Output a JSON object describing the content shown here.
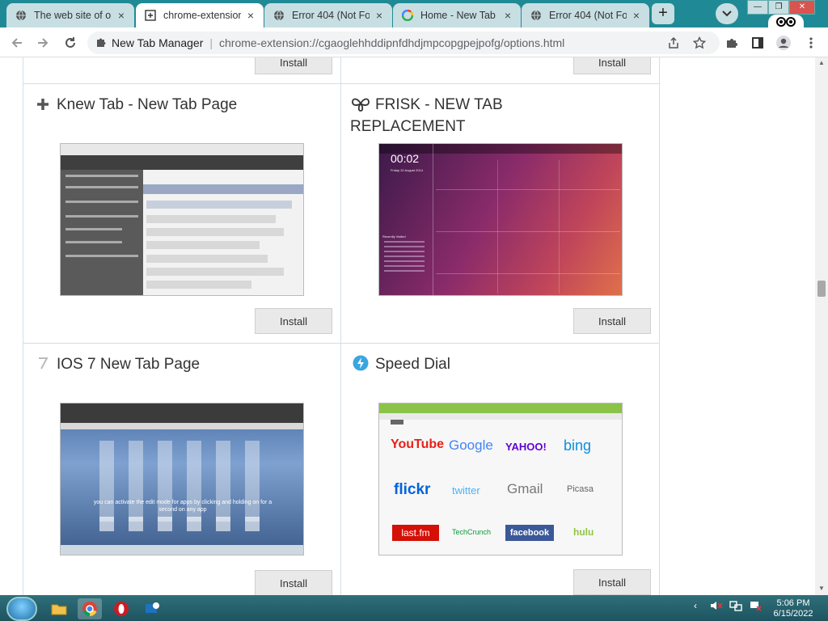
{
  "tabs": [
    {
      "title": "The web site of o",
      "active": false,
      "icon": "globe-icon"
    },
    {
      "title": "chrome-extension",
      "active": true,
      "icon": "extension-page-icon"
    },
    {
      "title": "Error 404 (Not Fo",
      "active": false,
      "icon": "globe-icon"
    },
    {
      "title": "Home - New Tab",
      "active": false,
      "icon": "google-icon"
    },
    {
      "title": "Error 404 (Not Fo",
      "active": false,
      "icon": "globe-icon"
    }
  ],
  "toolbar": {
    "site_name": "New Tab Manager",
    "url": "chrome-extension://cgaoglehhddipnfdhdjmpcopgpejpofg/options.html"
  },
  "cards": [
    {
      "title": "Knew Tab - New Tab Page",
      "icon": "plus-icon",
      "install_label": "Install"
    },
    {
      "title_line1": "FRISK - NEW TAB",
      "title_line2": "REPLACEMENT",
      "icon": "frisk-logo-icon",
      "install_label": "Install"
    },
    {
      "title": "IOS 7 New Tab Page",
      "icon": "seven-icon",
      "install_label": "Install"
    },
    {
      "title": "Speed Dial",
      "icon": "lightning-icon",
      "install_label": "Install"
    }
  ],
  "top_row": {
    "install_left": "Install",
    "install_right": "Install"
  },
  "screenshots": {
    "frisk": {
      "clock": "00:02",
      "date": "Friday 22 August 2014",
      "recently_visited": "Recently Visited"
    },
    "ios7": {
      "tip": "you can activate the edit mode for apps by clicking and holding on for a second on any app"
    },
    "speed_dial": {
      "tiles": [
        "YouTube",
        "Google",
        "YAHOO!",
        "bing",
        "flickr",
        "twitter",
        "Gmail",
        "Picasa",
        "last.fm",
        "TechCrunch",
        "facebook",
        "hulu"
      ]
    }
  },
  "taskbar": {
    "time": "5:06 PM",
    "date": "6/15/2022"
  },
  "colors": {
    "tabstrip": "#1f8a95",
    "tab_inactive": "#c7dfe3",
    "grid_line": "#cfe0e8",
    "speed_dial_accent": "#8bc34a"
  }
}
